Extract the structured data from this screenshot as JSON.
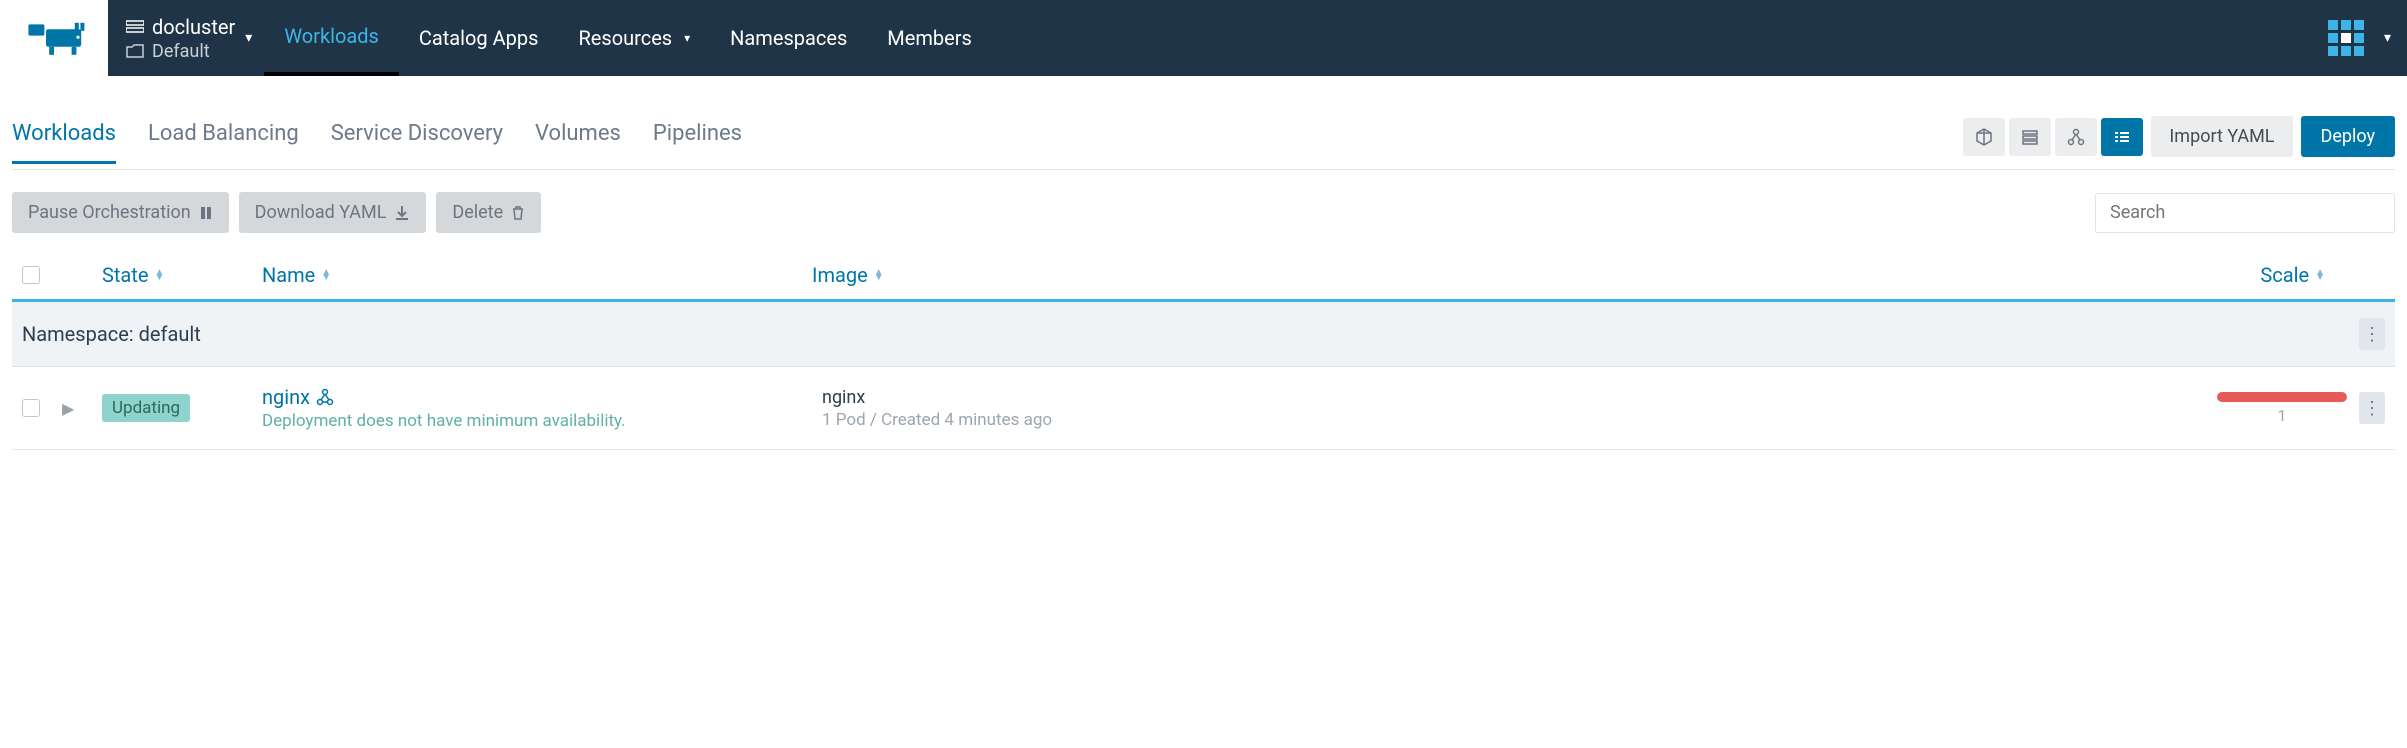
{
  "cluster": {
    "name": "docluster",
    "project": "Default"
  },
  "nav": {
    "workloads": "Workloads",
    "catalog": "Catalog Apps",
    "resources": "Resources",
    "namespaces": "Namespaces",
    "members": "Members"
  },
  "subtabs": {
    "workloads": "Workloads",
    "lb": "Load Balancing",
    "sd": "Service Discovery",
    "volumes": "Volumes",
    "pipelines": "Pipelines"
  },
  "buttons": {
    "import_yaml": "Import YAML",
    "deploy": "Deploy",
    "pause": "Pause Orchestration",
    "download": "Download YAML",
    "delete": "Delete"
  },
  "search": {
    "placeholder": "Search"
  },
  "columns": {
    "state": "State",
    "name": "Name",
    "image": "Image",
    "scale": "Scale"
  },
  "namespace": {
    "label": "Namespace: default"
  },
  "row": {
    "state": "Updating",
    "name": "nginx",
    "subtext": "Deployment does not have minimum availability.",
    "image": "nginx",
    "image_sub": "1 Pod / Created 4 minutes ago",
    "scale": "1"
  }
}
